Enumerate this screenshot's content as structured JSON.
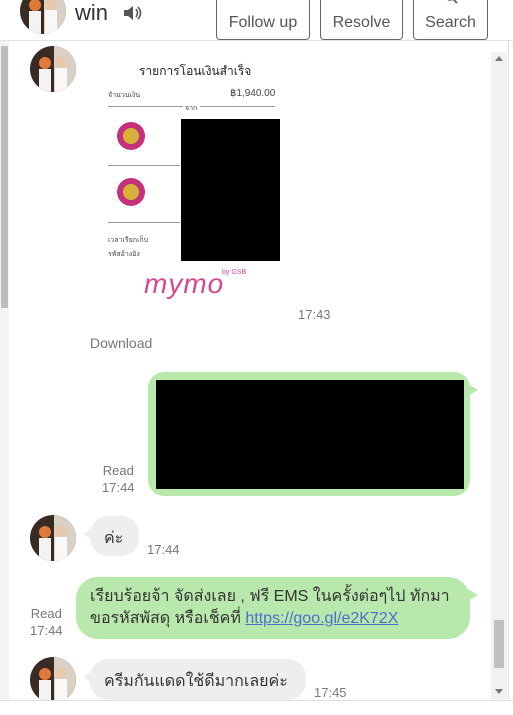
{
  "header": {
    "contact_name": "win",
    "buttons": {
      "follow_up": "Follow up",
      "resolve": "Resolve",
      "search": "Search"
    }
  },
  "messages": {
    "receipt_image": {
      "title": "รายการโอนเงินสำเร็จ",
      "amount_label": "จำนวนเงิน",
      "amount": "฿1,940.00",
      "from_label": "จาก",
      "time_label": "เวลาเรียกเก็บ",
      "ref_label": "รหัสอ้างอิง",
      "logo_text": "mymo",
      "logo_sub": "by GSB",
      "time": "17:43"
    },
    "download_label": "Download",
    "outgoing_image": {
      "status": "Read",
      "time": "17:44"
    },
    "incoming_1": {
      "text": "ค่ะ",
      "time": "17:44"
    },
    "outgoing_text": {
      "status": "Read",
      "time": "17:44",
      "text": "เรียบร้อยจ้า จัดส่งเลย , ฟรี EMS ในครั้งต่อๆไป ทักมาขอรหัสพัสดุ หรือเช็คที่ ",
      "link": "https://goo.gl/e2K72X"
    },
    "incoming_2": {
      "text": "ครีมกันแดดใช้ดีมากเลยค่ะ",
      "time": "17:45"
    }
  },
  "colors": {
    "outgoing_bubble": "#b9e8ad",
    "incoming_bubble": "#eeeeee",
    "link": "#4a6fd1"
  }
}
